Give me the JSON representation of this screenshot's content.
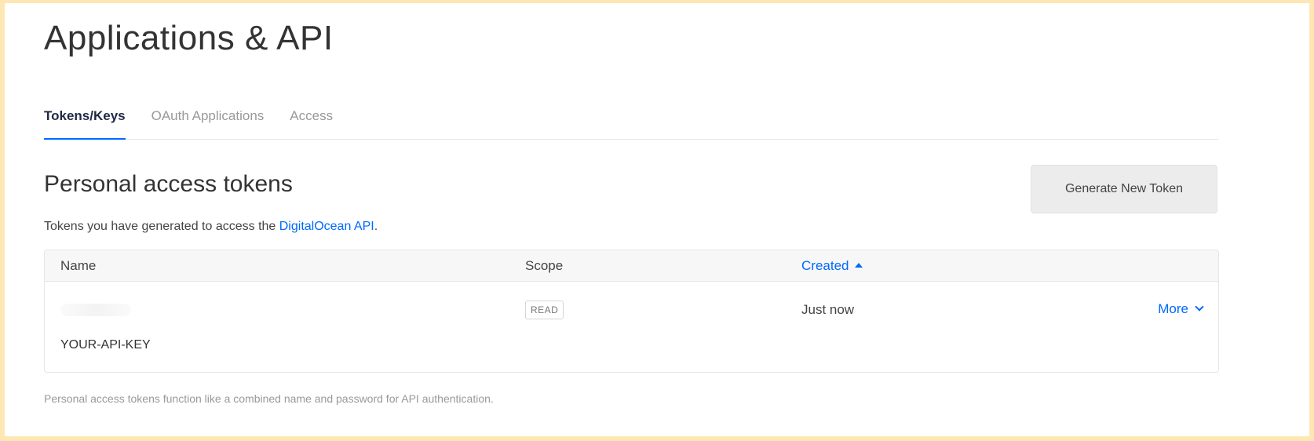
{
  "page": {
    "title": "Applications & API"
  },
  "tabs": [
    {
      "label": "Tokens/Keys",
      "active": true
    },
    {
      "label": "OAuth Applications",
      "active": false
    },
    {
      "label": "Access",
      "active": false
    }
  ],
  "section": {
    "title": "Personal access tokens",
    "desc_prefix": "Tokens you have generated to access the ",
    "desc_link": "DigitalOcean API",
    "desc_suffix": ".",
    "generate_button": "Generate New Token"
  },
  "table": {
    "columns": {
      "name": "Name",
      "scope": "Scope",
      "created": "Created"
    },
    "rows": [
      {
        "scope": "READ",
        "created": "Just now",
        "more": "More",
        "key": "YOUR-API-KEY"
      }
    ]
  },
  "footnote": "Personal access tokens function like a combined name and password for API authentication.",
  "colors": {
    "accent": "#0069ff",
    "frame": "#fde8b4"
  }
}
